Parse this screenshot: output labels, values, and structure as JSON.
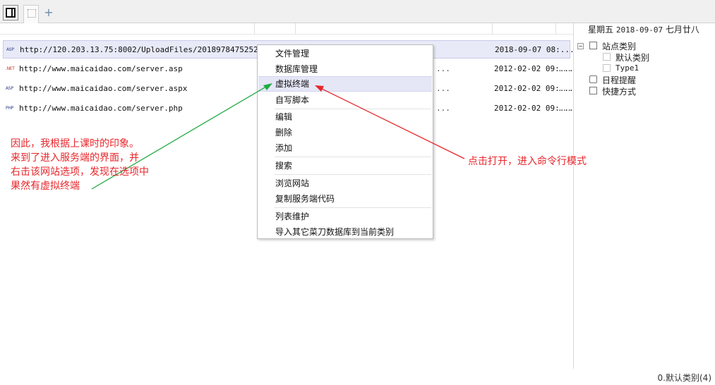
{
  "tabs": {
    "add_label": "+"
  },
  "sites": [
    {
      "icon": "ASP",
      "url": "http://120.203.13.75:8002/UploadFiles/20189784752524...",
      "ellipsis": "",
      "date": "2018-09-07 08:...",
      "tail": ""
    },
    {
      "icon": ".NET",
      "url": "http://www.maicaidao.com/server.asp",
      "ellipsis": "...",
      "date": "2012-02-02 09:...",
      "tail": "..."
    },
    {
      "icon": "ASP",
      "url": "http://www.maicaidao.com/server.aspx",
      "ellipsis": "...",
      "date": "2012-02-02 09:...",
      "tail": "..."
    },
    {
      "icon": "PHP",
      "url": "http://www.maicaidao.com/server.php",
      "ellipsis": "...",
      "date": "2012-02-02 09:...",
      "tail": "..."
    }
  ],
  "datebar": {
    "weekday": "星期五",
    "date": "2018-09-07",
    "lunar": "七月廿八"
  },
  "tree": {
    "expander": "−",
    "root": "站点类别",
    "children": [
      "默认类别",
      "Type1"
    ],
    "schedule": "日程提醒",
    "shortcut": "快捷方式"
  },
  "context_menu": {
    "items": [
      "文件管理",
      "数据库管理",
      "虚拟终端",
      "自写脚本",
      "编辑",
      "删除",
      "添加",
      "搜索",
      "浏览网站",
      "复制服务端代码",
      "列表维护",
      "导入其它菜刀数据库到当前类别"
    ],
    "highlighted": "虚拟终端"
  },
  "annotations": {
    "left": [
      "因此，我根据上课时的印象。",
      "来到了进入服务端的界面，并",
      "右击该网站选项，发现在选项中",
      "果然有虚拟终端"
    ],
    "right": "点击打开，进入命令行模式",
    "color": "#e8262b",
    "left_arrow_color": "#22aa44",
    "right_arrow_color": "#e8262b"
  },
  "status": {
    "text": "0.默认类别(4)"
  }
}
